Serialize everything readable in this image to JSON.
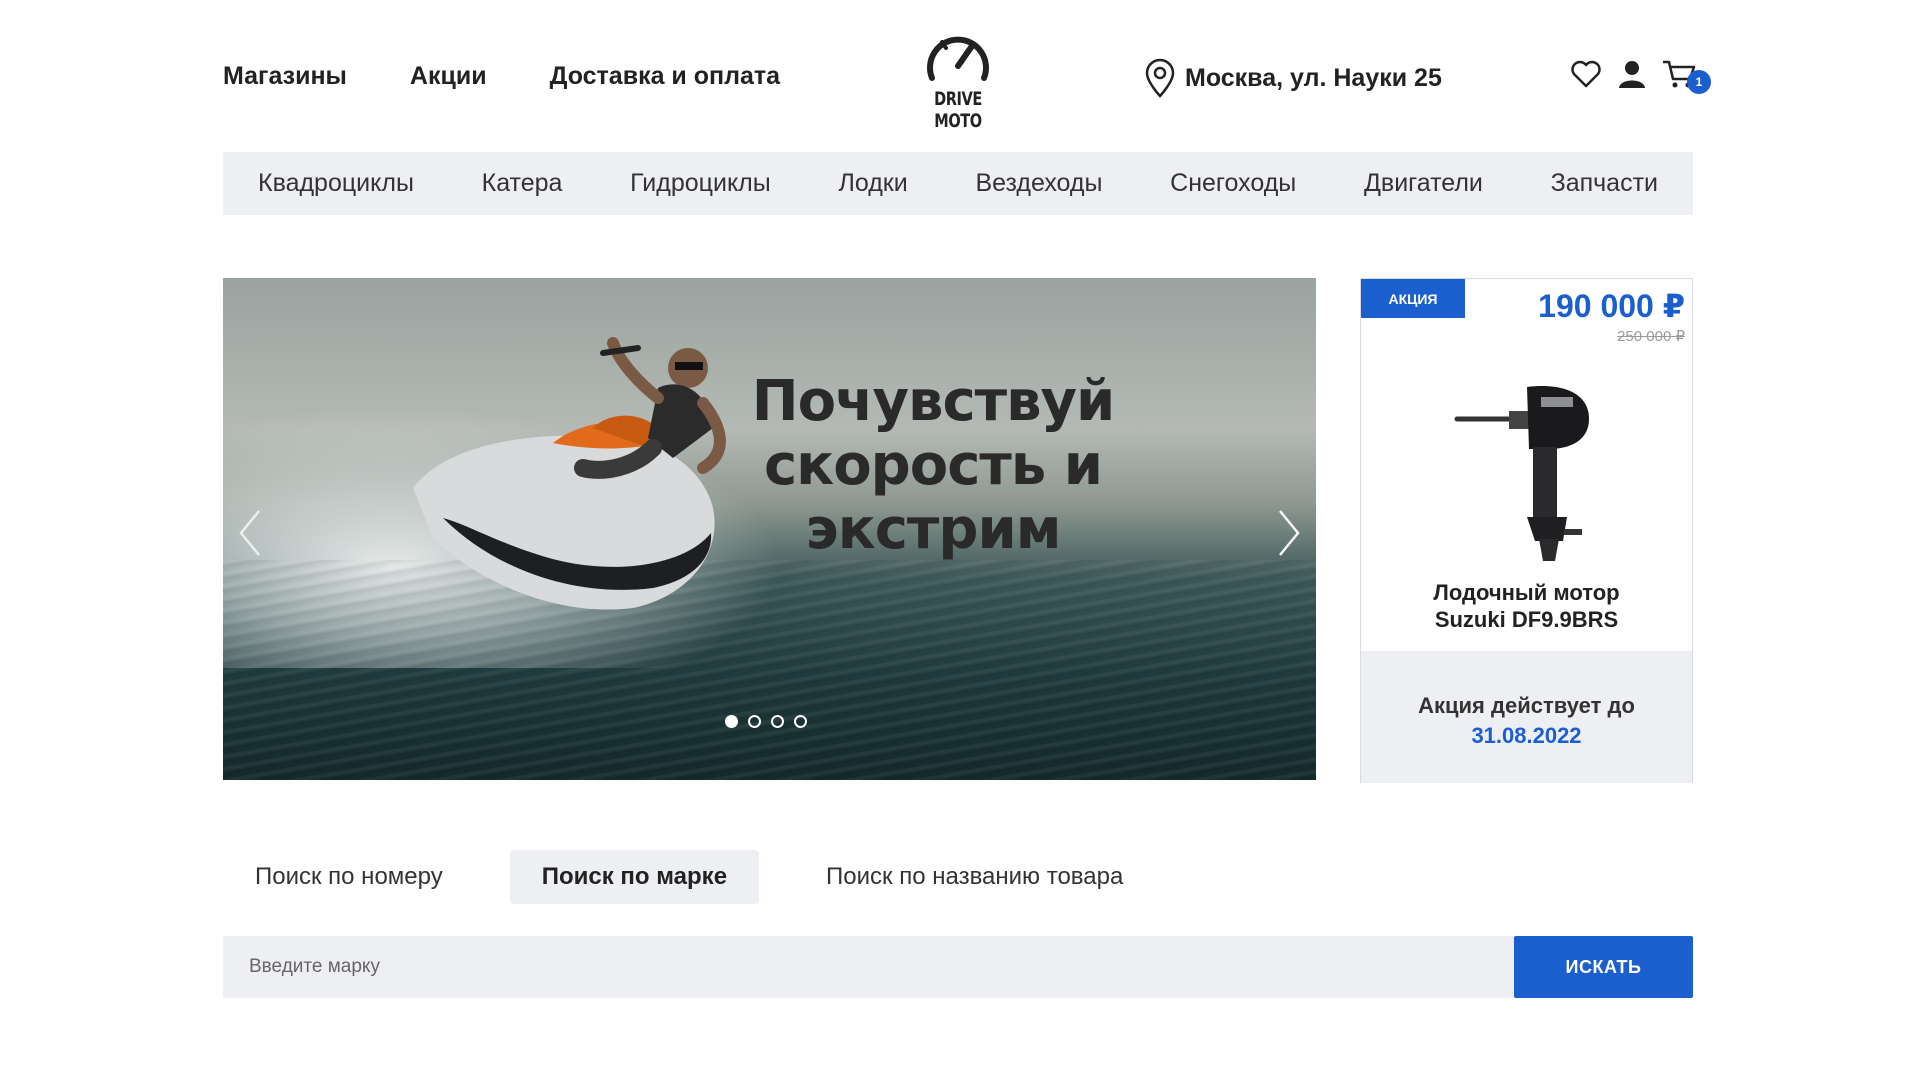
{
  "header": {
    "nav": [
      "Магазины",
      "Акции",
      "Доставка и оплата"
    ],
    "logo_text": "DRIVE MOTO",
    "address": "Москва, ул. Науки 25",
    "cart_count": "1"
  },
  "categories": [
    "Квадроциклы",
    "Катера",
    "Гидроциклы",
    "Лодки",
    "Вездеходы",
    "Снегоходы",
    "Двигатели",
    "Запчасти"
  ],
  "hero": {
    "headline_lines": [
      "Почувствуй",
      "скорость и",
      "экстрим"
    ],
    "slide_count": 4,
    "active_slide": 1
  },
  "promo": {
    "badge": "АКЦИЯ",
    "price": "190 000 ₽",
    "old_price": "250 000 ₽",
    "product_line1": "Лодочный мотор",
    "product_line2": "Suzuki DF9.9BRS",
    "valid_label": "Акция действует до",
    "valid_date": "31.08.2022"
  },
  "search": {
    "tabs": [
      "Поиск по номеру",
      "Поиск по марке",
      "Поиск по названию товара"
    ],
    "active_tab": 1,
    "placeholder": "Введите марку",
    "button_label": "ИСКАТЬ"
  },
  "colors": {
    "accent": "#1b5fcf",
    "bar_bg": "#eeeff3"
  }
}
